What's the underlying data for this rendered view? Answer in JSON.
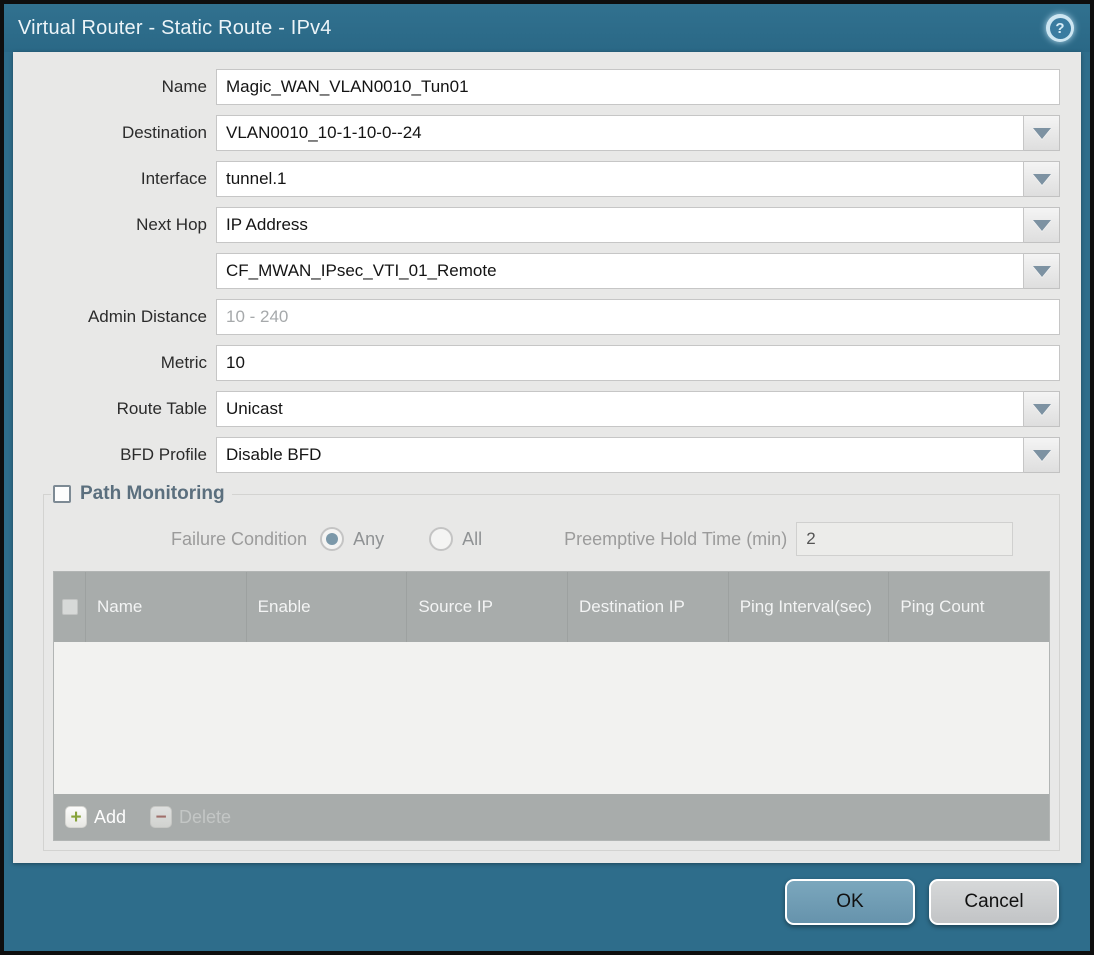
{
  "title_bar": {
    "title": "Virtual Router - Static Route - IPv4",
    "help_glyph": "?"
  },
  "form": {
    "rows": [
      {
        "label": "Name",
        "value": "Magic_WAN_VLAN0010_Tun01"
      },
      {
        "label": "Destination",
        "value": "VLAN0010_10-1-10-0--24"
      },
      {
        "label": "Interface",
        "value": "tunnel.1"
      },
      {
        "label": "Next Hop",
        "value": "IP Address"
      },
      {
        "label": "",
        "value": "CF_MWAN_IPsec_VTI_01_Remote"
      },
      {
        "label": "Admin Distance",
        "value": "",
        "placeholder": "10 - 240"
      },
      {
        "label": "Metric",
        "value": "10"
      },
      {
        "label": "Route Table",
        "value": "Unicast"
      },
      {
        "label": "BFD Profile",
        "value": "Disable BFD"
      }
    ]
  },
  "path_monitoring": {
    "legend": "Path Monitoring",
    "checkbox_checked": false,
    "failure_condition_label": "Failure Condition",
    "radio_any_label": "Any",
    "radio_all_label": "All",
    "radio_selected": "Any",
    "preemptive_label": "Preemptive Hold Time (min)",
    "preemptive_value": "2",
    "table": {
      "columns": [
        "Name",
        "Enable",
        "Source IP",
        "Destination IP",
        "Ping Interval(sec)",
        "Ping Count"
      ],
      "rows": []
    },
    "add_label": "Add",
    "delete_label": "Delete",
    "add_glyph": "+",
    "delete_glyph": "−"
  },
  "footer": {
    "ok_label": "OK",
    "cancel_label": "Cancel"
  },
  "colors": {
    "titlebar_teal": "#2e6d8b",
    "body_gray": "#e8e8e7",
    "table_header_gray": "#a8acab",
    "add_green": "#87a33a",
    "delete_red": "#9c4f4a",
    "radio_selected_fill": "#7b98a9",
    "ok_button": "#6e9db5"
  }
}
